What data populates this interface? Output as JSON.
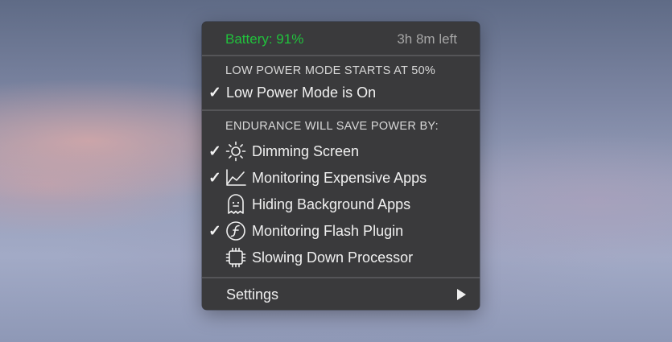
{
  "header": {
    "battery_label": "Battery: 91%",
    "time_left": "3h 8m left"
  },
  "low_power": {
    "section_title": "LOW POWER MODE STARTS AT 50%",
    "item": {
      "label": "Low Power Mode is On",
      "checked": true
    }
  },
  "endurance": {
    "section_title": "ENDURANCE WILL SAVE POWER BY:",
    "items": [
      {
        "label": "Dimming Screen",
        "icon": "sun-icon",
        "checked": true
      },
      {
        "label": "Monitoring Expensive Apps",
        "icon": "chart-icon",
        "checked": true
      },
      {
        "label": "Hiding Background Apps",
        "icon": "ghost-icon",
        "checked": false
      },
      {
        "label": "Monitoring Flash Plugin",
        "icon": "flash-plugin-icon",
        "checked": true
      },
      {
        "label": "Slowing Down Processor",
        "icon": "processor-icon",
        "checked": false
      }
    ]
  },
  "settings": {
    "label": "Settings",
    "icon": "submenu-arrow-icon"
  },
  "colors": {
    "battery_green": "#21c23c",
    "menu_background": "#3a3a3c"
  }
}
